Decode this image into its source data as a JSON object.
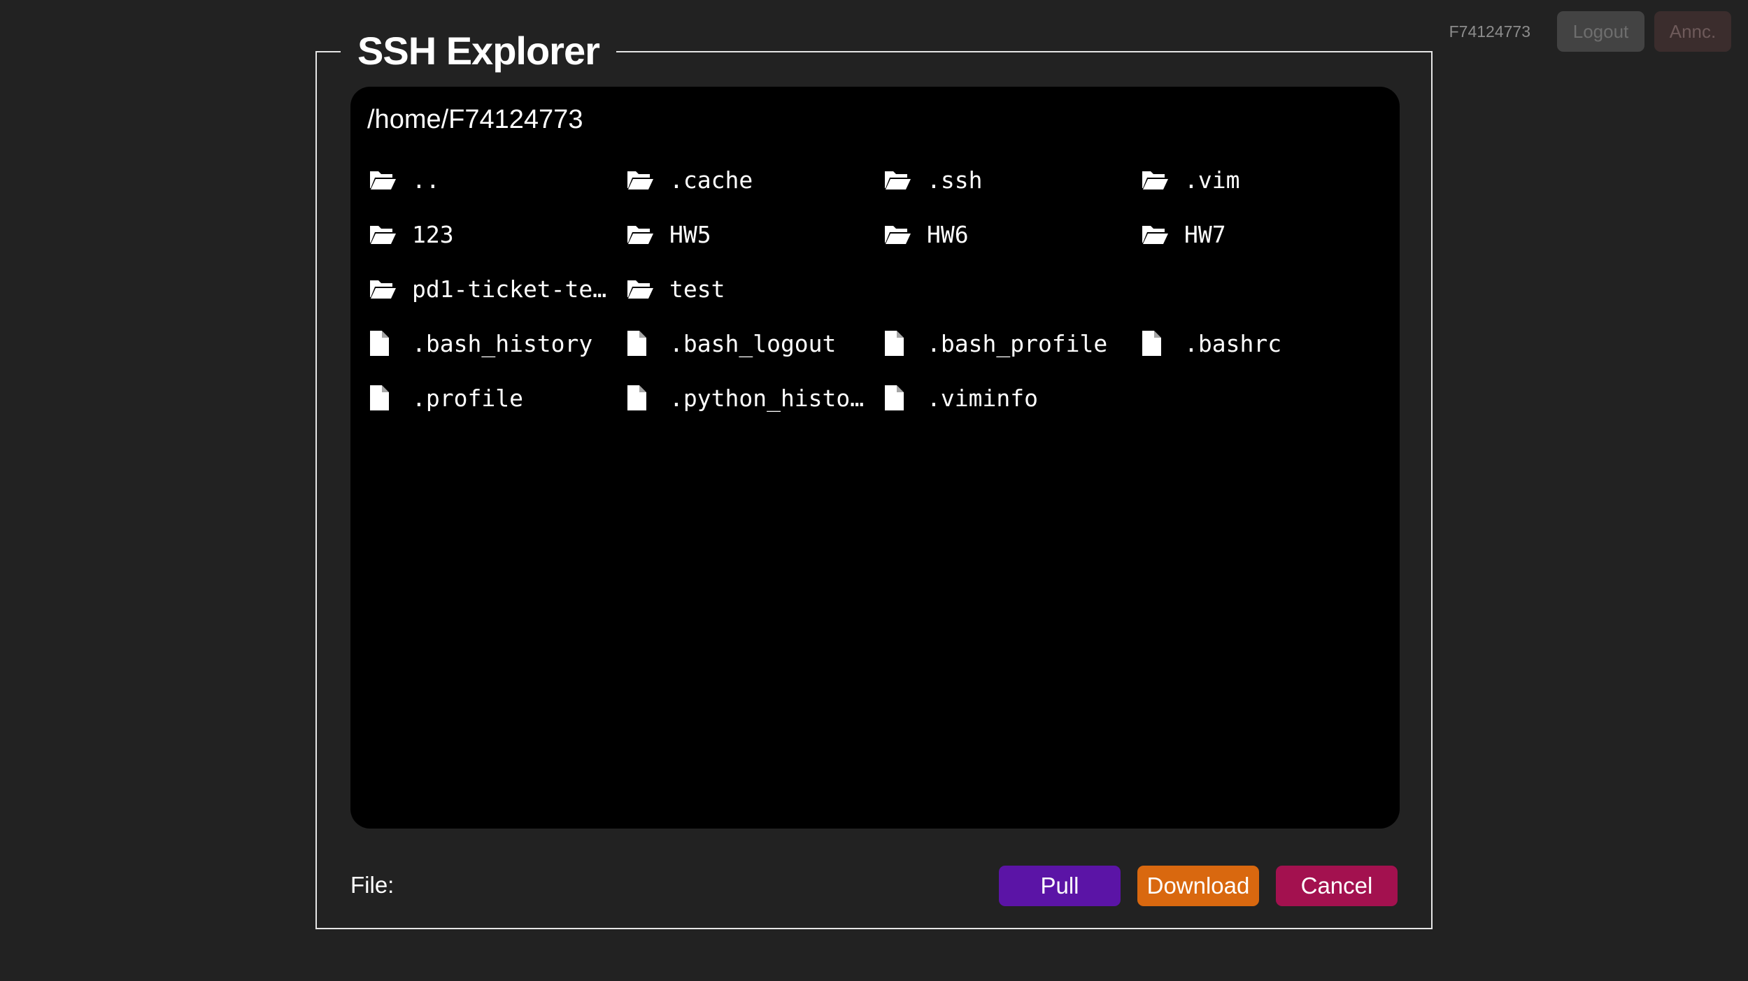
{
  "header": {
    "user_id": "F74124773",
    "logout_label": "Logout",
    "annc_label": "Annc."
  },
  "explorer": {
    "title": "SSH Explorer",
    "path": "/home/F74124773",
    "entries": [
      {
        "type": "folder",
        "name": ".."
      },
      {
        "type": "folder",
        "name": ".cache"
      },
      {
        "type": "folder",
        "name": ".ssh"
      },
      {
        "type": "folder",
        "name": ".vim"
      },
      {
        "type": "folder",
        "name": "123"
      },
      {
        "type": "folder",
        "name": "HW5"
      },
      {
        "type": "folder",
        "name": "HW6"
      },
      {
        "type": "folder",
        "name": "HW7"
      },
      {
        "type": "folder",
        "name": "pd1-ticket-te…"
      },
      {
        "type": "folder",
        "name": "test"
      },
      {
        "type": "file",
        "name": ".bash_history"
      },
      {
        "type": "file",
        "name": ".bash_logout"
      },
      {
        "type": "file",
        "name": ".bash_profile"
      },
      {
        "type": "file",
        "name": ".bashrc"
      },
      {
        "type": "file",
        "name": ".profile"
      },
      {
        "type": "file",
        "name": ".python_histo…"
      },
      {
        "type": "file",
        "name": ".viminfo"
      }
    ],
    "file_label": "File:",
    "pull_label": "Pull",
    "download_label": "Download",
    "cancel_label": "Cancel"
  },
  "icons": {
    "folder": "folder-open-icon",
    "file": "file-icon"
  },
  "colors": {
    "background": "#222222",
    "browser_bg": "#000000",
    "pull": "#5b14a6",
    "download": "#d9680f",
    "cancel": "#a3114f"
  }
}
